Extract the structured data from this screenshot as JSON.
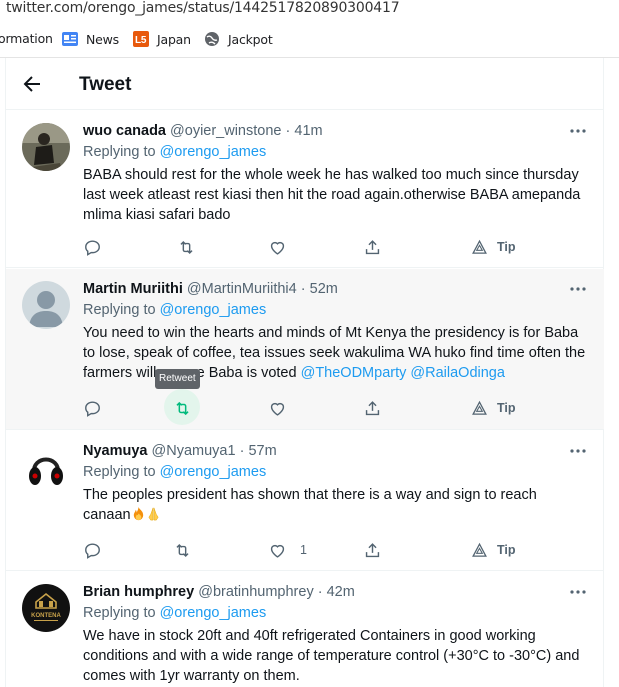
{
  "browser": {
    "url": "twitter.com/orengo_james/status/1442517820890300417",
    "bookmarks": [
      {
        "label": "ormation"
      },
      {
        "label": "News"
      },
      {
        "label": "Japan"
      },
      {
        "label": "Jackpot"
      }
    ]
  },
  "header": {
    "title": "Tweet"
  },
  "tweets": [
    {
      "name": "wuo canada",
      "handle": "@oyier_winstone",
      "sep": "·",
      "time": "41m",
      "replying_prefix": "Replying to ",
      "replying_to": "@orengo_james",
      "text": "BABA should rest for the whole week he has walked too much since thursday last week atleast rest kiasi then hit the road again.otherwise BABA amepanda mlima kiasi safari bado",
      "like_count": "",
      "tip_label": "Tip"
    },
    {
      "name": "Martin Muriithi",
      "handle": "@MartinMuriithi4",
      "sep": "·",
      "time": "52m",
      "replying_prefix": "Replying to ",
      "replying_to": "@orengo_james",
      "text": "You need to win the hearts and minds of Mt Kenya the presidency is for Baba to lose, speak of coffee, tea  issues seek wakulima WA huko find time often the farmers will ensure Baba is voted ",
      "mention_1": "@TheODMparty",
      "mention_2": "@RailaOdinga",
      "like_count": "",
      "tip_label": "Tip",
      "tooltip": "Retweet"
    },
    {
      "name": "Nyamuya",
      "handle": "@Nyamuya1",
      "sep": "·",
      "time": "57m",
      "replying_prefix": "Replying to ",
      "replying_to": "@orengo_james",
      "text": "The peoples president has shown that there is a way and sign to reach canaan",
      "like_count": "1",
      "tip_label": "Tip"
    },
    {
      "name": "Brian humphrey",
      "handle": "@bratinhumphrey",
      "sep": "·",
      "time": "42m",
      "replying_prefix": "Replying to ",
      "replying_to": "@orengo_james",
      "text": "We have in stock 20ft and 40ft refrigerated Containers in good working conditions and with a wide range of temperature control (+30°C to -30°C) and comes with 1yr warranty on them.",
      "avatar_text": "KONTENA"
    }
  ],
  "colors": {
    "accent": "#1d9bf0",
    "retweet_green": "#00ba7c",
    "muted": "#536471"
  }
}
